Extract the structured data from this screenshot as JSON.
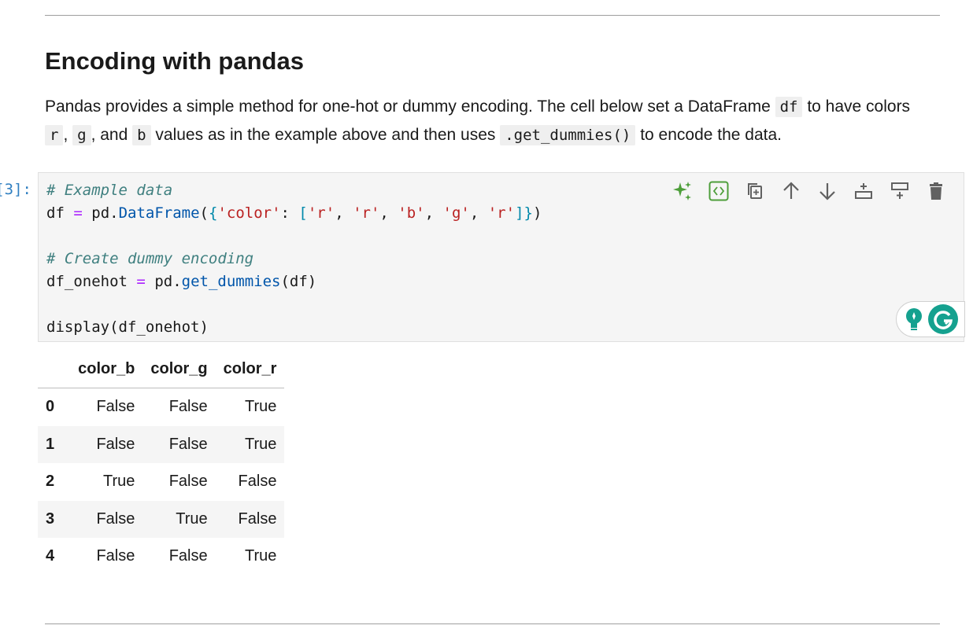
{
  "markdown": {
    "heading": "Encoding with pandas",
    "para": {
      "t1": "Pandas provides a simple method for one-hot or dummy encoding. The cell below set a DataFrame ",
      "c1": "df",
      "t2": " to have colors ",
      "c2": "r",
      "t3": ", ",
      "c3": "g",
      "t4": ", and ",
      "c4": "b",
      "t5": " values as in the example above and then uses ",
      "c5": ".get_dummies()",
      "t6": " to encode the data."
    }
  },
  "cell": {
    "prompt": "[3]:",
    "code": {
      "comment1": "# Example data",
      "line2_var": "df",
      "line2_eq": "=",
      "line2_obj": "pd.",
      "line2_fn": "DataFrame",
      "line2_p1": "(",
      "line2_b1": "{",
      "line2_key": "'color'",
      "line2_colon": ": ",
      "line2_b2": "[",
      "line2_s1": "'r'",
      "line2_s2": "'r'",
      "line2_s3": "'b'",
      "line2_s4": "'g'",
      "line2_s5": "'r'",
      "line2_b3": "]",
      "line2_b4": "}",
      "line2_p2": ")",
      "comment2": "# Create dummy encoding",
      "line5_var": "df_onehot",
      "line5_eq": "=",
      "line5_obj": "pd.",
      "line5_fn": "get_dummies",
      "line5_args": "(df)",
      "line7": "display(df_onehot)"
    },
    "toolbar_icons": [
      "sparkle-icon",
      "code-view-icon",
      "duplicate-icon",
      "arrow-up-icon",
      "arrow-down-icon",
      "insert-above-icon",
      "insert-below-icon",
      "trash-icon"
    ]
  },
  "output_table": {
    "columns": [
      "",
      "color_b",
      "color_g",
      "color_r"
    ],
    "rows": [
      {
        "index": "0",
        "color_b": "False",
        "color_g": "False",
        "color_r": "True"
      },
      {
        "index": "1",
        "color_b": "False",
        "color_g": "False",
        "color_r": "True"
      },
      {
        "index": "2",
        "color_b": "True",
        "color_g": "False",
        "color_r": "False"
      },
      {
        "index": "3",
        "color_b": "False",
        "color_g": "True",
        "color_r": "False"
      },
      {
        "index": "4",
        "color_b": "False",
        "color_g": "False",
        "color_r": "True"
      }
    ]
  },
  "colors": {
    "toolbar_green": "#4d9e3a",
    "toolbar_gray": "#616161",
    "grammarly_green": "#15a18f",
    "prompt_blue": "#307fc1"
  }
}
